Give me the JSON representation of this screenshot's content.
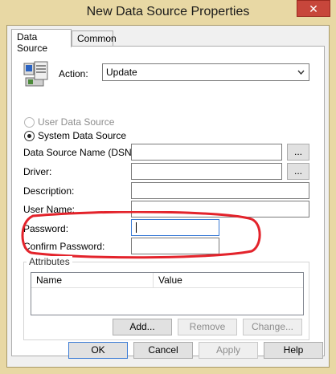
{
  "window": {
    "title": "New Data Source Properties",
    "close_glyph": "✕"
  },
  "tabs": [
    {
      "label": "Data Source"
    },
    {
      "label": "Common"
    }
  ],
  "action": {
    "label": "Action:",
    "value": "Update"
  },
  "radios": [
    {
      "label": "User Data Source",
      "selected": false,
      "enabled": false
    },
    {
      "label": "System Data Source",
      "selected": true,
      "enabled": true
    }
  ],
  "fields": {
    "dsn": {
      "label": "Data Source Name (DSN):",
      "value": ""
    },
    "driver": {
      "label": "Driver:",
      "value": ""
    },
    "description": {
      "label": "Description:",
      "value": ""
    },
    "username": {
      "label": "User Name:",
      "value": ""
    },
    "password": {
      "label": "Password:",
      "value": ""
    },
    "confirm": {
      "label": "Confirm Password:",
      "value": ""
    }
  },
  "browse_label": "...",
  "attributes": {
    "title": "Attributes",
    "columns": [
      "Name",
      "Value"
    ],
    "add": "Add...",
    "remove": "Remove",
    "change": "Change..."
  },
  "footer": {
    "ok": "OK",
    "cancel": "Cancel",
    "apply": "Apply",
    "help": "Help"
  },
  "colors": {
    "frame": "#e8d8a4",
    "close": "#c7463b",
    "highlight": "#e3232b",
    "focus": "#3a7bd5"
  }
}
